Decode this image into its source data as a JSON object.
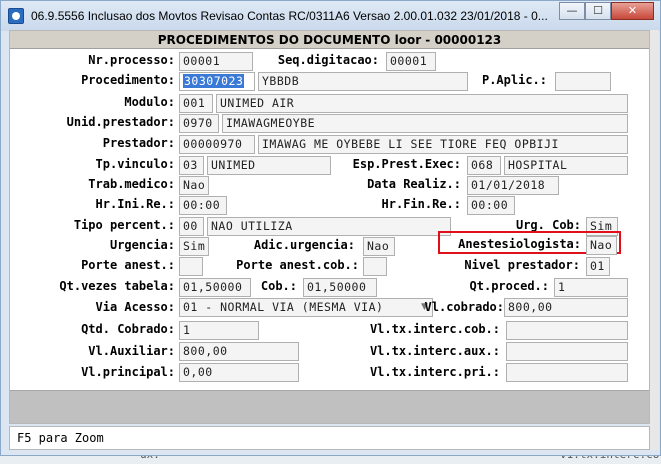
{
  "window": {
    "title": "06.9.5556  Inclusao  dos Movtos Revisao Contas RC/0311A6 Versao 2.00.01.032 23/01/2018 - 0...",
    "minimize": "—",
    "maximize": "☐",
    "close": "✕"
  },
  "panel": {
    "title": "PROCEDIMENTOS DO DOCUMENTO loor - 00000123"
  },
  "status": {
    "text": "F5 para Zoom"
  },
  "background": {
    "left": "ux.",
    "right": "v1.tx.interc.co"
  },
  "fields": {
    "nr_processo": {
      "label": "Nr.processo:",
      "value": "00001"
    },
    "seq_digitacao": {
      "label": "Seq.digitacao:",
      "value": "00001"
    },
    "procedimento": {
      "label": "Procedimento:",
      "value": "30307023",
      "desc": "YBBDB"
    },
    "p_aplic": {
      "label": "P.Aplic.:",
      "value": ""
    },
    "modulo": {
      "label": "Modulo:",
      "value": "001",
      "desc": "UNIMED AIR"
    },
    "unid_prestador": {
      "label": "Unid.prestador:",
      "value": "0970",
      "desc": "IMAWAGMEOYBE"
    },
    "prestador": {
      "label": "Prestador:",
      "value": "00000970",
      "desc": "IMAWAG ME OYBEBE LI SEE TIORE FEQ OPBIJI"
    },
    "tp_vinculo": {
      "label": "Tp.vinculo:",
      "value": "03",
      "desc": "UNIMED"
    },
    "esp_prest_exec": {
      "label": "Esp.Prest.Exec:",
      "value": "068",
      "desc": "HOSPITAL"
    },
    "trab_medico": {
      "label": "Trab.medico:",
      "value": "Nao"
    },
    "data_realiz": {
      "label": "Data Realiz.:",
      "value": "01/01/2018"
    },
    "hr_ini_re": {
      "label": "Hr.Ini.Re.:",
      "value": "00:00"
    },
    "hr_fin_re": {
      "label": "Hr.Fin.Re.:",
      "value": "00:00"
    },
    "tipo_percent": {
      "label": "Tipo percent.:",
      "value": "00",
      "desc": "NAO UTILIZA"
    },
    "urg_cob": {
      "label": "Urg. Cob:",
      "value": "Sim"
    },
    "urgencia": {
      "label": "Urgencia:",
      "value": "Sim"
    },
    "adic_urgencia": {
      "label": "Adic.urgencia:",
      "value": "Nao"
    },
    "anestesiologista": {
      "label": "Anestesiologista:",
      "value": "Nao"
    },
    "porte_anest": {
      "label": "Porte anest.:",
      "value": ""
    },
    "porte_anest_cob": {
      "label": "Porte anest.cob.:",
      "value": ""
    },
    "nivel_prestador": {
      "label": "Nivel prestador:",
      "value": "01"
    },
    "qt_vezes_tabela": {
      "label": "Qt.vezes tabela:",
      "value": "01,50000"
    },
    "cob": {
      "label": "Cob.:",
      "value": "01,50000"
    },
    "qt_proced": {
      "label": "Qt.proced.:",
      "value": "1"
    },
    "via_acesso": {
      "label": "Via Acesso:",
      "value": "01 - NORMAL VIA (MESMA VIA)"
    },
    "vl_cobrado": {
      "label": "Vl.cobrado:",
      "value": "800,00"
    },
    "qtd_cobrado": {
      "label": "Qtd. Cobrado:",
      "value": "1"
    },
    "vl_tx_interc_cob": {
      "label": "Vl.tx.interc.cob.:",
      "value": ""
    },
    "vl_auxiliar": {
      "label": "Vl.Auxiliar:",
      "value": "800,00"
    },
    "vl_tx_interc_aux": {
      "label": "Vl.tx.interc.aux.:",
      "value": ""
    },
    "vl_principal": {
      "label": "Vl.principal:",
      "value": "0,00"
    },
    "vl_tx_interc_pri": {
      "label": "Vl.tx.interc.pri.:",
      "value": ""
    }
  }
}
